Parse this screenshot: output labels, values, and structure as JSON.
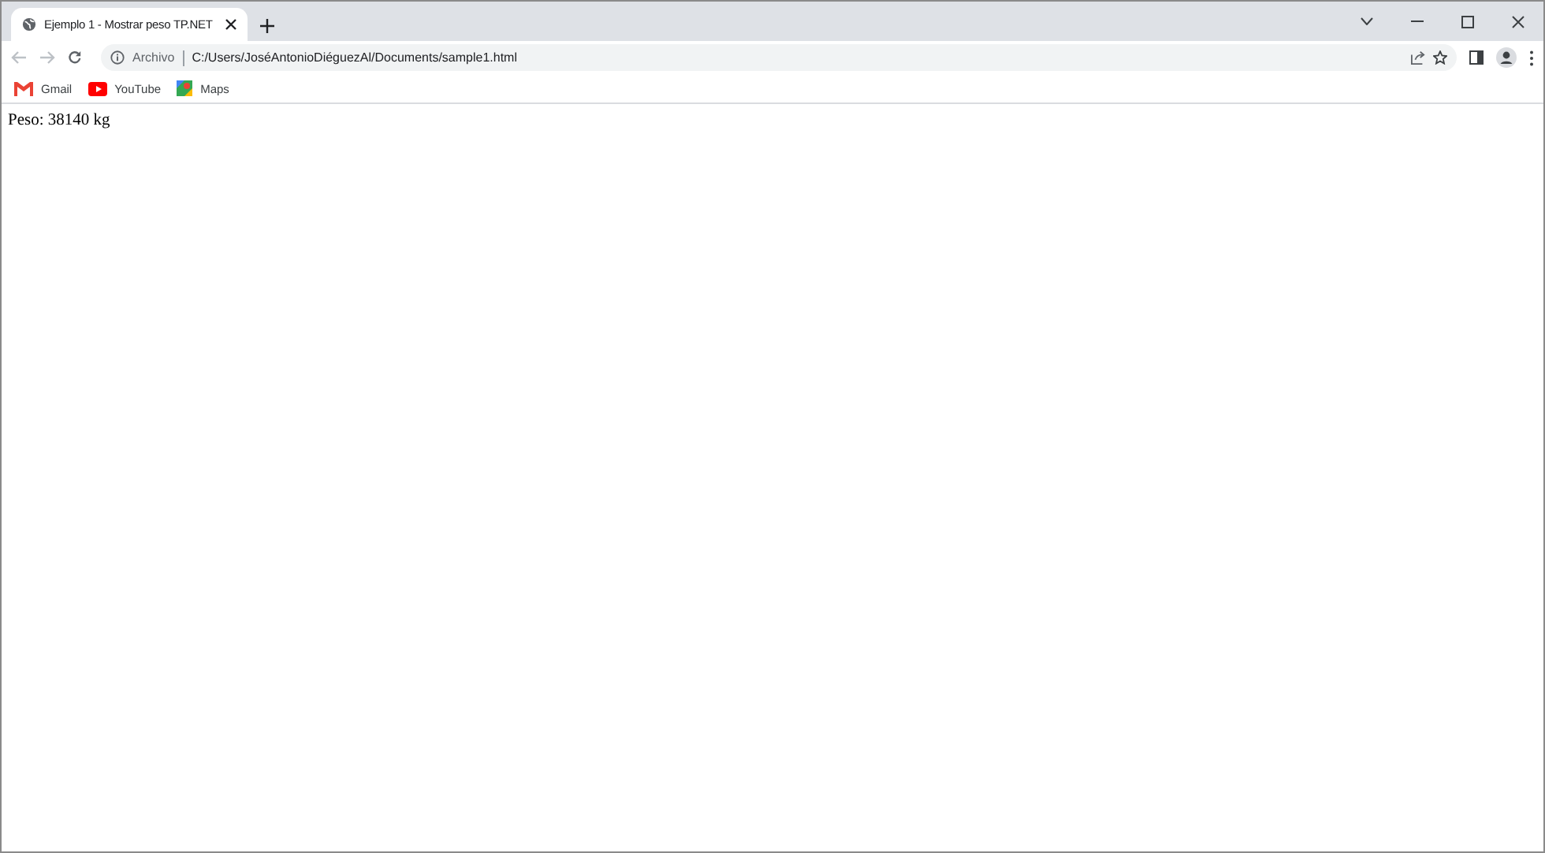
{
  "tab": {
    "title": "Ejemplo 1 - Mostrar peso TP.NET",
    "selected": true
  },
  "address_bar": {
    "security_label": "Archivo",
    "url": "C:/Users/JoséAntonioDiéguezAl/Documents/sample1.html"
  },
  "bookmarks": [
    {
      "kind": "gmail",
      "label": "Gmail"
    },
    {
      "kind": "youtube",
      "label": "YouTube"
    },
    {
      "kind": "maps",
      "label": "Maps"
    }
  ],
  "page": {
    "text": "Peso: 38140 kg"
  }
}
